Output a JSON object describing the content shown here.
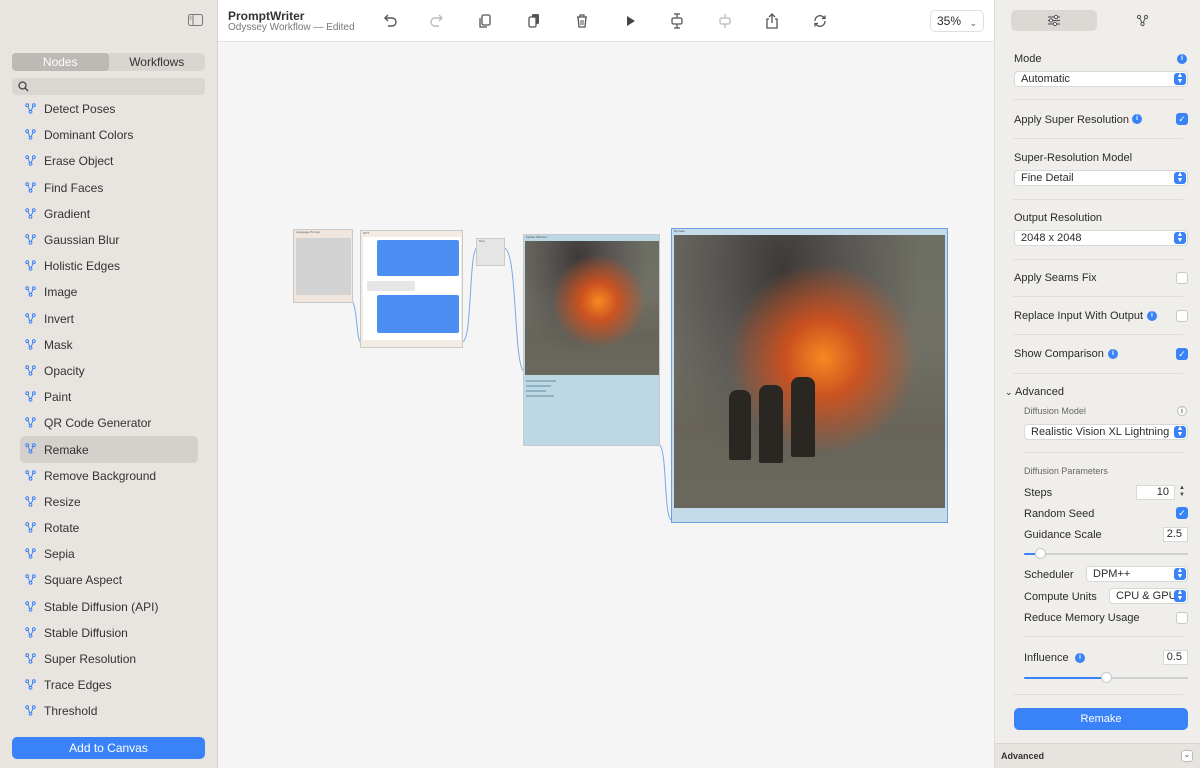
{
  "sidebar": {
    "tabs": [
      "Nodes",
      "Workflows"
    ],
    "active_tab": "Nodes",
    "items": [
      "Detect Poses",
      "Dominant Colors",
      "Erase Object",
      "Find Faces",
      "Gradient",
      "Gaussian Blur",
      "Holistic Edges",
      "Image",
      "Invert",
      "Mask",
      "Opacity",
      "Paint",
      "QR Code Generator",
      "Remake",
      "Remove Background",
      "Resize",
      "Rotate",
      "Sepia",
      "Square Aspect",
      "Stable Diffusion (API)",
      "Stable Diffusion",
      "Super Resolution",
      "Trace Edges",
      "Threshold"
    ],
    "selected_item": "Remake",
    "add_button": "Add to Canvas"
  },
  "toolbar": {
    "app_name": "PromptWriter",
    "document": "Odyssey Workflow",
    "status": "Edited",
    "zoom": "35%"
  },
  "canvas": {
    "nodes": {
      "language_prompt": "Language Prompt",
      "gpt": "GPT",
      "text": "Text",
      "mobile_diffusion": "Mobile Diffusion",
      "remake": "Remake"
    }
  },
  "panel": {
    "mode_label": "Mode",
    "mode_value": "Automatic",
    "apply_super_resolution": "Apply Super Resolution",
    "apply_super_resolution_checked": true,
    "super_resolution_model_label": "Super-Resolution Model",
    "super_resolution_model_value": "Fine Detail",
    "output_resolution_label": "Output Resolution",
    "output_resolution_value": "2048 x 2048",
    "apply_seams_fix": "Apply Seams Fix",
    "apply_seams_fix_checked": false,
    "replace_input": "Replace Input With Output",
    "replace_input_checked": false,
    "show_comparison": "Show Comparison",
    "show_comparison_checked": true,
    "advanced": "Advanced",
    "diffusion_model_label": "Diffusion Model",
    "diffusion_model_value": "Realistic Vision XL Lightning",
    "diffusion_params_label": "Diffusion Parameters",
    "steps_label": "Steps",
    "steps_value": "10",
    "random_seed_label": "Random Seed",
    "random_seed_checked": true,
    "guidance_label": "Guidance Scale",
    "guidance_value": "2.5",
    "guidance_fraction": 0.1,
    "scheduler_label": "Scheduler",
    "scheduler_value": "DPM++",
    "compute_label": "Compute Units",
    "compute_value": "CPU & GPU",
    "reduce_memory_label": "Reduce Memory Usage",
    "reduce_memory_checked": false,
    "influence_label": "Influence",
    "influence_value": "0.5",
    "influence_fraction": 0.5,
    "action_button": "Remake",
    "footer_label": "Advanced"
  }
}
